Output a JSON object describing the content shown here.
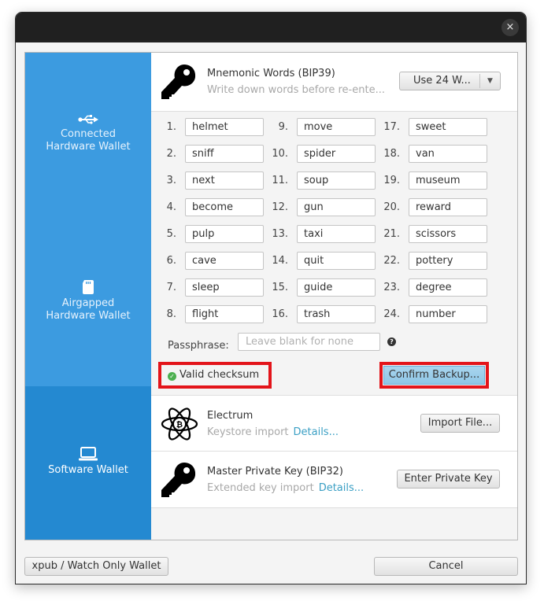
{
  "window": {
    "close_label": "×"
  },
  "sidebar": {
    "items": [
      {
        "label_line1": "Connected",
        "label_line2": "Hardware Wallet",
        "icon": "usb-icon",
        "active": false
      },
      {
        "label_line1": "Airgapped",
        "label_line2": "Hardware Wallet",
        "icon": "sd-card-icon",
        "active": false
      },
      {
        "label_line1": "Software Wallet",
        "label_line2": "",
        "icon": "laptop-icon",
        "active": true
      }
    ]
  },
  "mnemonic": {
    "title": "Mnemonic Words (BIP39)",
    "subtitle": "Write down words before re-ente...",
    "word_count_button": "Use 24 W...",
    "words": [
      "helmet",
      "sniff",
      "next",
      "become",
      "pulp",
      "cave",
      "sleep",
      "flight",
      "move",
      "spider",
      "soup",
      "gun",
      "taxi",
      "quit",
      "guide",
      "trash",
      "sweet",
      "van",
      "museum",
      "reward",
      "scissors",
      "pottery",
      "degree",
      "number"
    ],
    "passphrase_label": "Passphrase:",
    "passphrase_value": "",
    "passphrase_placeholder": "Leave blank for none",
    "checksum_status": "Valid checksum",
    "confirm_button": "Confirm Backup..."
  },
  "electrum": {
    "title": "Electrum",
    "subtitle": "Keystore import",
    "details_link": "Details...",
    "button": "Import File..."
  },
  "master_key": {
    "title": "Master Private Key (BIP32)",
    "subtitle": "Extended key import",
    "details_link": "Details...",
    "button": "Enter Private Key"
  },
  "footer": {
    "watch_only_button": "xpub / Watch Only Wallet",
    "cancel_button": "Cancel"
  },
  "colors": {
    "sidebar": "#3c9be0",
    "sidebar_active": "#2489d1",
    "highlight": "#e3141a",
    "link": "#3a9fc4",
    "checksum_ok": "#4caf50"
  }
}
